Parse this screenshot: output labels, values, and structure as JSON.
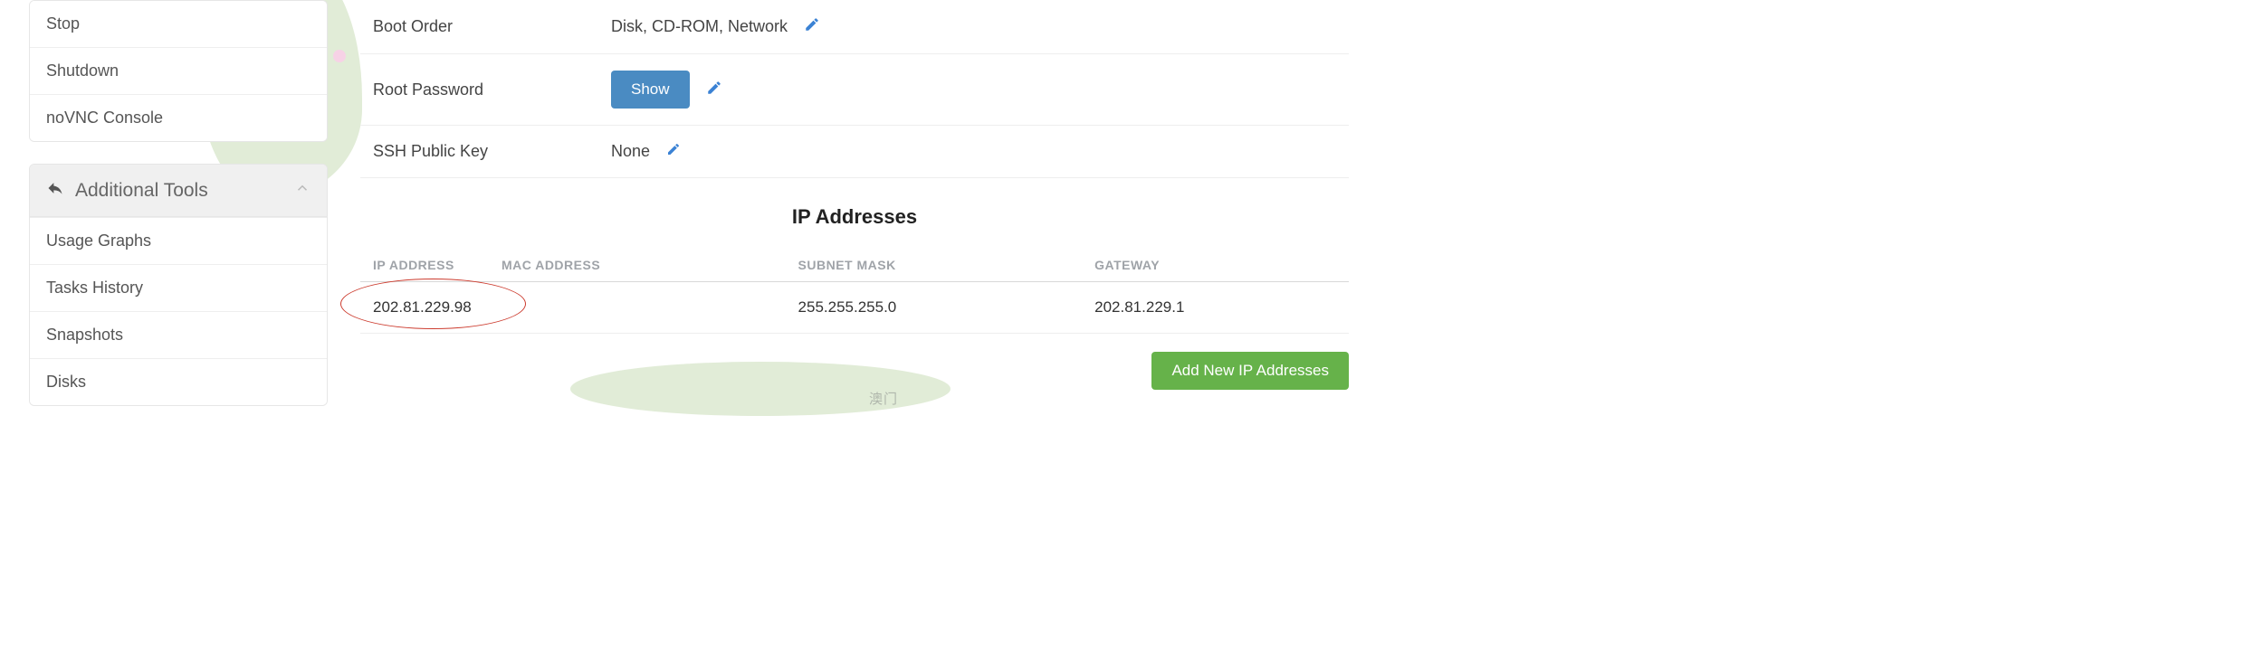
{
  "sidebar": {
    "actions": [
      {
        "label": "Stop"
      },
      {
        "label": "Shutdown"
      },
      {
        "label": "noVNC Console"
      }
    ],
    "tools_header": "Additional Tools",
    "tools": [
      {
        "label": "Usage Graphs"
      },
      {
        "label": "Tasks History"
      },
      {
        "label": "Snapshots"
      },
      {
        "label": "Disks"
      }
    ]
  },
  "rows": {
    "boot_order": {
      "label": "Boot Order",
      "value": "Disk, CD-ROM, Network"
    },
    "root_password": {
      "label": "Root Password",
      "button": "Show"
    },
    "ssh_key": {
      "label": "SSH Public Key",
      "value": "None"
    }
  },
  "ip_section": {
    "title": "IP Addresses",
    "headers": {
      "ip": "IP ADDRESS",
      "mac": "MAC ADDRESS",
      "mask": "SUBNET MASK",
      "gw": "GATEWAY"
    },
    "rows": [
      {
        "ip": "202.81.229.98",
        "mac": "",
        "mask": "255.255.255.0",
        "gw": "202.81.229.1"
      }
    ],
    "add_button": "Add New IP Addresses"
  },
  "bg_text": "澳门",
  "colors": {
    "primary": "#4a8bc2",
    "success": "#66b24a",
    "edit_icon": "#3b82d4",
    "highlight": "#cc3b2e"
  }
}
